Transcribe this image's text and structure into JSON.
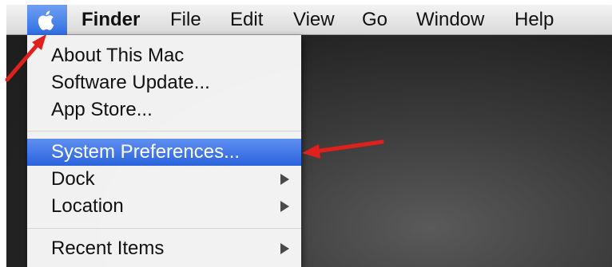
{
  "menubar": {
    "apple_icon": "apple-logo-icon",
    "items": [
      "Finder",
      "File",
      "Edit",
      "View",
      "Go",
      "Window",
      "Help"
    ]
  },
  "apple_menu": {
    "items": [
      {
        "label": "About This Mac"
      },
      {
        "label": "Software Update..."
      },
      {
        "label": "App Store..."
      },
      {
        "label": "System Preferences...",
        "highlighted": true
      },
      {
        "label": "Dock",
        "has_submenu": true
      },
      {
        "label": "Location",
        "has_submenu": true
      },
      {
        "label": "Recent Items",
        "has_submenu": true
      }
    ]
  },
  "annotations": {
    "arrow_color": "#e0201c",
    "highlight_color": "#3a6fe3"
  }
}
